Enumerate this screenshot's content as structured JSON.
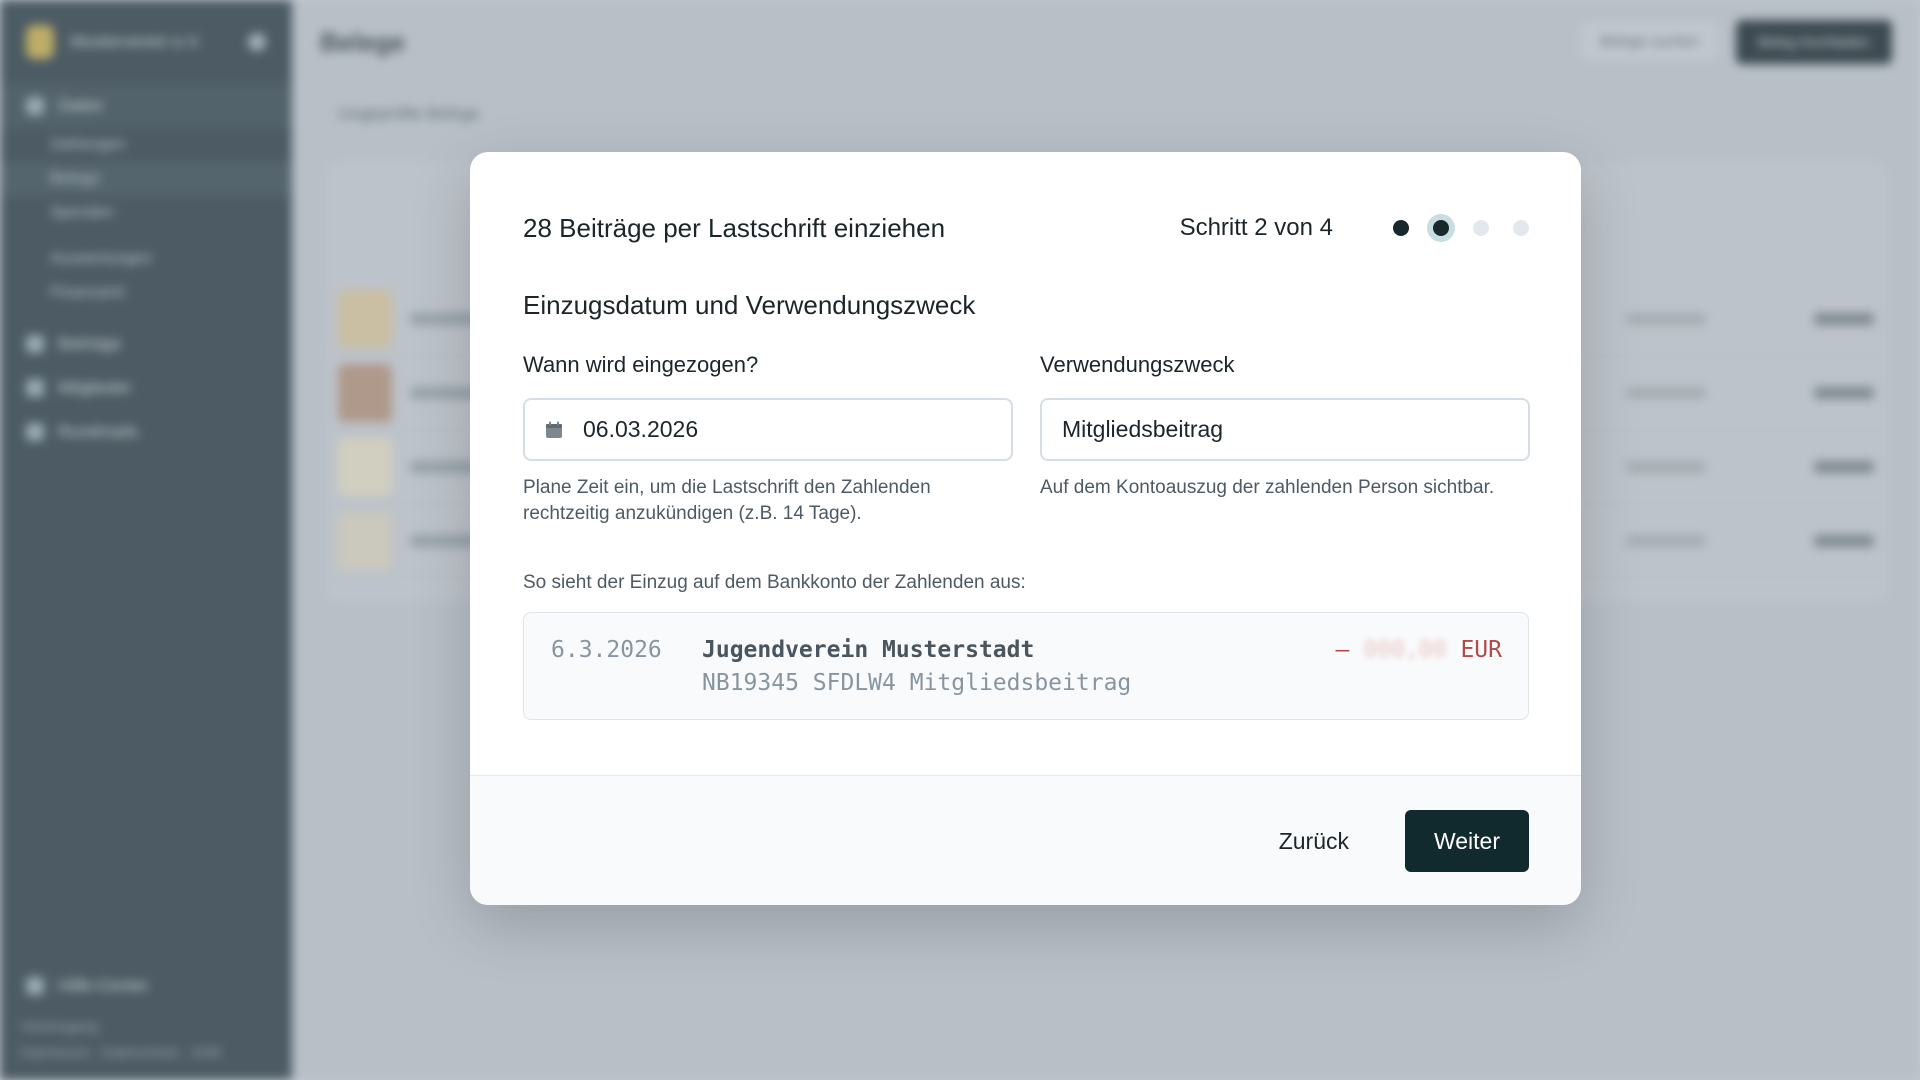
{
  "background": {
    "sidebar": {
      "org_name": "Musterverein e.V.",
      "items": [
        {
          "label": "Daten"
        },
        {
          "label": "Zahlungen"
        },
        {
          "label": "Belege"
        },
        {
          "label": "Spenden"
        },
        {
          "label": "Auswertungen"
        },
        {
          "label": "Finanzamt"
        },
        {
          "label": "Beiträge"
        },
        {
          "label": "Mitglieder"
        },
        {
          "label": "Rundmails"
        }
      ],
      "help": "Hilfe-Center",
      "footer_user": "Vereinsgang",
      "footer_links": "Impressum · Datenschutz · AGB"
    },
    "topbar": {
      "title": "Belege",
      "search_button": "Belege suchen",
      "primary_button": "Beleg hochladen"
    },
    "breadcrumb": "Ungeprüfte Belege"
  },
  "modal": {
    "title": "28 Beiträge per Lastschrift einziehen",
    "step_text": "Schritt 2 von 4",
    "steps_total": 4,
    "step_current": 2,
    "subtitle": "Einzugsdatum und Verwendungszweck",
    "date_field": {
      "label": "Wann wird eingezogen?",
      "value": "06.03.2026",
      "help": "Plane Zeit ein, um die Lastschrift den Zahlenden rechtzeitig anzukündigen (z.B. 14 Tage)."
    },
    "purpose_field": {
      "label": "Verwendungszweck",
      "value": "Mitgliedsbeitrag",
      "help": "Auf dem Kontoauszug der zahlenden Person sichtbar."
    },
    "preview_label": "So sieht der Einzug auf dem Bankkonto der Zahlenden aus:",
    "preview": {
      "date": "6.3.2026",
      "name": "Jugendverein Musterstadt",
      "reference": "NB19345 SFDLW4 Mitgliedsbeitrag",
      "sign": "–",
      "amount_hidden": "000,00",
      "currency": "EUR"
    },
    "footer": {
      "back_label": "Zurück",
      "next_label": "Weiter"
    }
  },
  "colors": {
    "accent_dark": "#112a2d",
    "amount_red": "#b14a4a",
    "step_ring": "#c8dde2"
  }
}
